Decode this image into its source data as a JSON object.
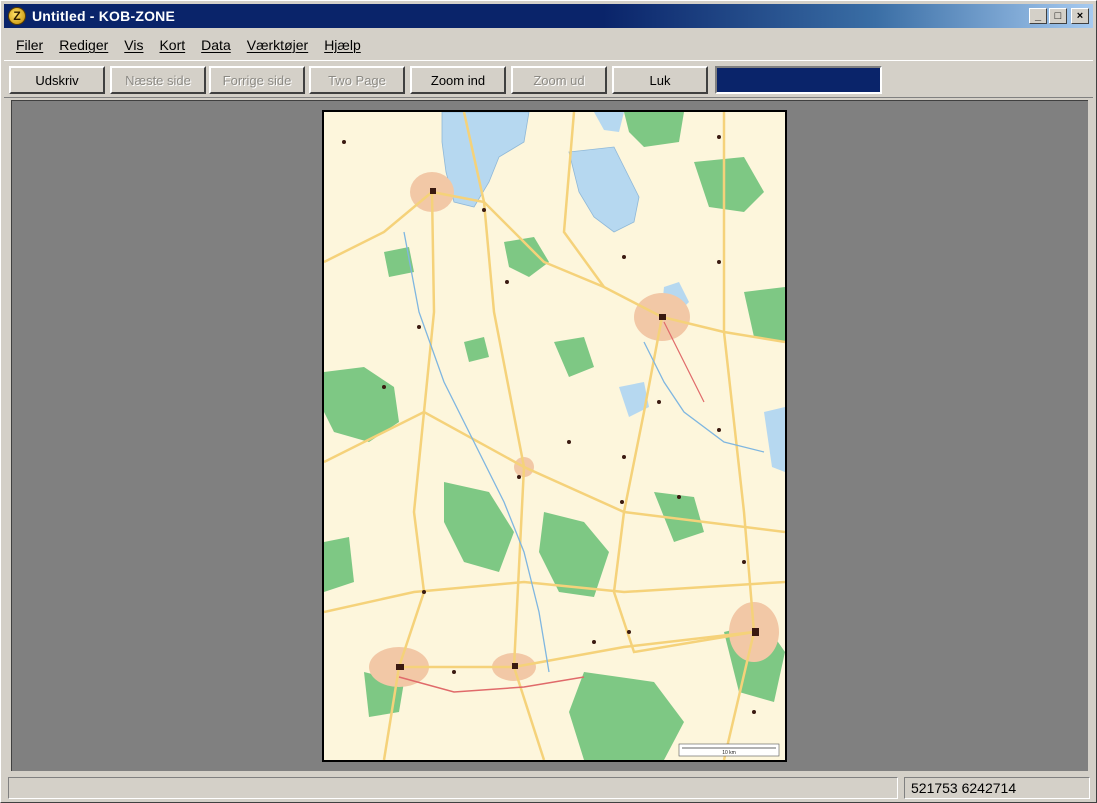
{
  "window": {
    "title": "Untitled - KOB-ZONE",
    "app_icon_letter": "Z"
  },
  "title_controls": {
    "minimize": "_",
    "maximize": "□",
    "close": "×"
  },
  "menu": [
    "Filer",
    "Rediger",
    "Vis",
    "Kort",
    "Data",
    "Værktøjer",
    "Hjælp"
  ],
  "toolbar": {
    "print": "Udskriv",
    "next_page": "Næste side",
    "prev_page": "Forrige side",
    "two_page": "Two Page",
    "zoom_in": "Zoom ind",
    "zoom_out": "Zoom ud",
    "close": "Luk"
  },
  "map": {
    "scale_label": "10 km"
  },
  "statusbar": {
    "main": "",
    "coords": "521753 6242714"
  },
  "colors": {
    "titlebar": "#0a246a",
    "map_land": "#fdf6dc",
    "forest": "#7ec884",
    "water": "#b6d8f0",
    "road": "#f5d27a",
    "town": "#f2c8a6"
  }
}
